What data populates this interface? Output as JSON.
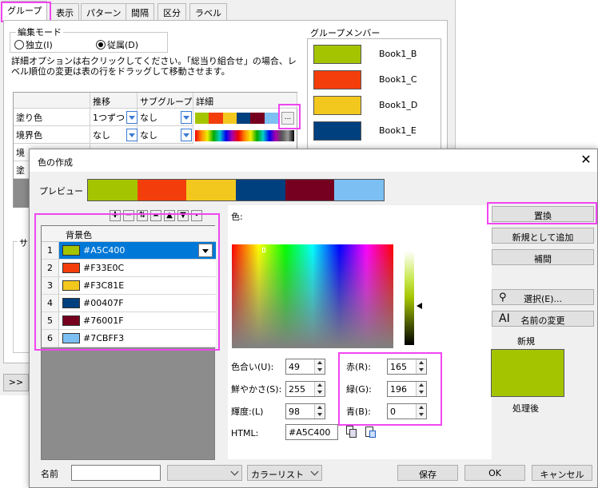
{
  "back": {
    "tabs": [
      "グループ",
      "表示",
      "パターン",
      "間隔",
      "区分",
      "ラベル"
    ],
    "edit_mode": {
      "label": "編集モード",
      "opt1": "独立(I)",
      "opt2": "従属(D)"
    },
    "instructions": "詳細オプションは右クリックしてください。「総当り組合せ」の場合、レベル順位の変更は表の行をドラッグして移動させます。",
    "grid": {
      "headers": [
        "推移",
        "サブグループ",
        "詳細"
      ],
      "rows": [
        {
          "name": "塗り色",
          "step": "1つずつ",
          "sub": "なし"
        },
        {
          "name": "境界色",
          "step": "なし",
          "sub": "なし"
        },
        {
          "name": "境",
          "step": "",
          "sub": ""
        },
        {
          "name": "塗",
          "step": "",
          "sub": ""
        }
      ],
      "more_btn": "..."
    },
    "sub_label": "サ",
    "expand_btn": ">>",
    "members": {
      "label": "グループメンバー",
      "items": [
        {
          "name": "Book1_B",
          "color": "#A5C400"
        },
        {
          "name": "Book1_C",
          "color": "#F33E0C"
        },
        {
          "name": "Book1_D",
          "color": "#F3C81E"
        },
        {
          "name": "Book1_E",
          "color": "#00407F"
        }
      ]
    }
  },
  "dialog": {
    "title": "色の作成",
    "close_icon": "close-icon",
    "preview_label": "プレビュー",
    "color_label": "色:",
    "list": {
      "header": "背景色",
      "rows": [
        {
          "n": "1",
          "hex": "#A5C400"
        },
        {
          "n": "2",
          "hex": "#F33E0C"
        },
        {
          "n": "3",
          "hex": "#F3C81E"
        },
        {
          "n": "4",
          "hex": "#00407F"
        },
        {
          "n": "5",
          "hex": "#76001F"
        },
        {
          "n": "6",
          "hex": "#7CBFF3"
        }
      ]
    },
    "hsl": {
      "hue_label": "色合い(U):",
      "hue": "49",
      "sat_label": "鮮やかさ(S):",
      "sat": "255",
      "lum_label": "輝度:(L)",
      "lum": "98"
    },
    "rgb": {
      "r_label": "赤(R):",
      "r": "165",
      "g_label": "緑(G):",
      "g": "196",
      "b_label": "青(B):",
      "b": "0"
    },
    "html_label": "HTML:",
    "html_value": "#A5C400",
    "buttons": {
      "replace": "置換",
      "add_new": "新規として追加",
      "interpolate": "補間",
      "select": "選択(E)...",
      "rename": "名前の変更",
      "save": "保存",
      "ok": "OK",
      "cancel": "キャンセル"
    },
    "new_label": "新規",
    "after_label": "処理後",
    "new_color": "#A5C400",
    "name_label": "名前",
    "colorlist_combo": "カラーリスト"
  }
}
